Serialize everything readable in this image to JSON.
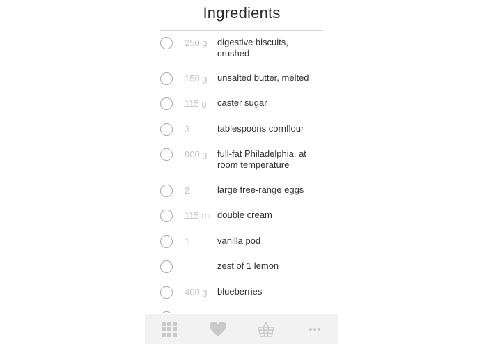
{
  "header": {
    "title": "Ingredients"
  },
  "ingredients": [
    {
      "qty": "250 g",
      "name": "digestive biscuits, crushed"
    },
    {
      "qty": "150 g",
      "name": "unsalted butter, melted"
    },
    {
      "qty": "115 g",
      "name": "caster sugar"
    },
    {
      "qty": "3",
      "name": "tablespoons cornflour"
    },
    {
      "qty": "900 g",
      "name": "full-fat Philadelphia, at room temperature"
    },
    {
      "qty": "2",
      "name": "large free-range eggs"
    },
    {
      "qty": "115 ml",
      "name": "double cream"
    },
    {
      "qty": "1",
      "name": "vanilla pod"
    },
    {
      "qty": "",
      "name": "zest of 1 lemon"
    },
    {
      "qty": "400 g",
      "name": "blueberries"
    }
  ],
  "tabbar": {
    "tabs": [
      {
        "icon": "grid-icon"
      },
      {
        "icon": "heart-icon"
      },
      {
        "icon": "basket-icon"
      },
      {
        "icon": "more-icon"
      }
    ]
  },
  "colors": {
    "text": "#2f2f2f",
    "quantity": "#c4c4c4",
    "icon": "#c9c9c9",
    "tabbar_bg": "#f2f2f2"
  }
}
